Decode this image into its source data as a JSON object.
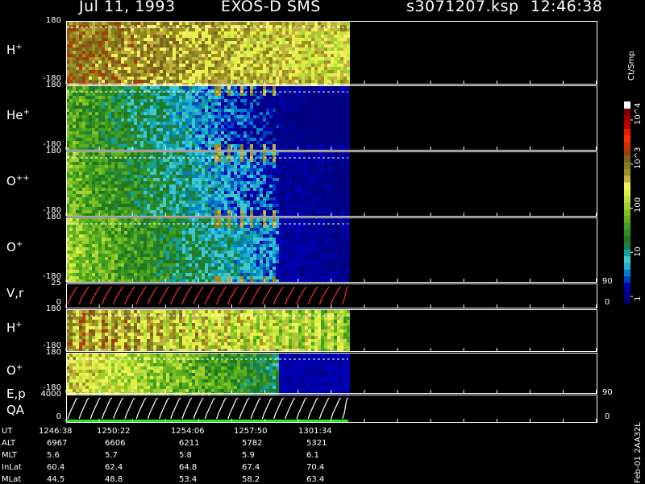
{
  "header": {
    "date": "Jul 11, 1993",
    "instrument": "EXOS-D SMS",
    "file": "s3071207.ksp",
    "time": "12:46:38"
  },
  "colorbar": {
    "units": "Ct/Smp",
    "ticks": [
      {
        "label": "1",
        "value": 1
      },
      {
        "label": "10",
        "value": 10
      },
      {
        "label": "100",
        "value": 100
      },
      {
        "label": "10^3",
        "value": 1000
      },
      {
        "label": "10^4",
        "value": 10000
      }
    ],
    "colors": [
      "#000080",
      "#00008c",
      "#0000b4",
      "#0040c0",
      "#0080c8",
      "#20b0d0",
      "#40c8d0",
      "#10a0a0",
      "#208040",
      "#207820",
      "#308c20",
      "#40a020",
      "#60b020",
      "#80c020",
      "#a0d030",
      "#c0e040",
      "#e0f040",
      "#f0f060",
      "#c0b040",
      "#a09020",
      "#808020",
      "#806020",
      "#a04000",
      "#d03000",
      "#ff3000",
      "#e02000",
      "#c00000",
      "#a00000",
      "#800000",
      "#ffffff"
    ]
  },
  "chart_data": {
    "type": "heatmap",
    "x_axis": "UT",
    "panels": [
      {
        "name": "H+",
        "label": "H",
        "sup": "+",
        "ymax_label": "180",
        "ymin_label": "-180",
        "ylim": [
          -180,
          180
        ],
        "level": 0.72,
        "decay": 0.25,
        "spikes": true
      },
      {
        "name": "He+",
        "label": "He",
        "sup": "+",
        "ymax_label": "180",
        "ymin_label": "-180",
        "ylim": [
          -180,
          180
        ],
        "level": 0.42,
        "decay": 0.85,
        "spikes": true
      },
      {
        "name": "O++",
        "label": "O",
        "sup": "++",
        "ymax_label": "180",
        "ymin_label": "-180",
        "ylim": [
          -180,
          180
        ],
        "level": 0.45,
        "decay": 0.8,
        "spikes": true
      },
      {
        "name": "O+",
        "label": "O",
        "sup": "+",
        "ymax_label": "180",
        "ymin_label": "-180",
        "ylim": [
          -180,
          180
        ],
        "level": 0.5,
        "decay": 0.8,
        "spikes": true
      },
      {
        "name": "V,r",
        "label": "V,r",
        "sup": "",
        "ymax_label": "25",
        "ymin_label": "0",
        "ylim": [
          0,
          25
        ],
        "right_top": "90",
        "right_bottom": "0",
        "kind": "sawtooth",
        "color": "#ff3020"
      },
      {
        "name": "H+ (2)",
        "label": "H",
        "sup": "+",
        "ymax_label": "180",
        "ymin_label": "-180",
        "ylim": [
          -180,
          180
        ],
        "level": 0.62,
        "decay": 0.3,
        "spikes": false,
        "stripes": true
      },
      {
        "name": "O+ (2)",
        "label": "O",
        "sup": "+",
        "ymax_label": "180",
        "ymin_label": "-180",
        "ylim": [
          -180,
          180
        ],
        "level": 0.62,
        "decay": 0.7,
        "spikes": false
      },
      {
        "name": "E,p QA",
        "label": "E,p",
        "sup": "",
        "label2": "QA",
        "ymax_label": "4000",
        "ymin_label": "0",
        "ylim": [
          0,
          4000
        ],
        "right_top": "90",
        "right_bottom": "0",
        "kind": "sawtooth",
        "color": "#ffffff"
      }
    ],
    "ephemeris": {
      "rows": [
        "UT",
        "ALT",
        "MLT",
        "InLat",
        "MLat"
      ],
      "columns": [
        {
          "UT": "1246:38",
          "ALT": "6967",
          "MLT": "5.6",
          "InLat": "60.4",
          "MLat": "44.5"
        },
        {
          "UT": "1250:22",
          "ALT": "6606",
          "MLT": "5.7",
          "InLat": "62.4",
          "MLat": "48.8"
        },
        {
          "UT": "1254:06",
          "ALT": "6211",
          "MLT": "5.8",
          "InLat": "64.8",
          "MLat": "53.4"
        },
        {
          "UT": "1257:50",
          "ALT": "5782",
          "MLT": "5.9",
          "InLat": "67.4",
          "MLat": "58.2"
        },
        {
          "UT": "1301:34",
          "ALT": "5321",
          "MLT": "6.1",
          "InLat": "70.4",
          "MLat": "63.4"
        }
      ]
    }
  },
  "footer": {
    "stamp": "Feb-01 2AA32L"
  }
}
